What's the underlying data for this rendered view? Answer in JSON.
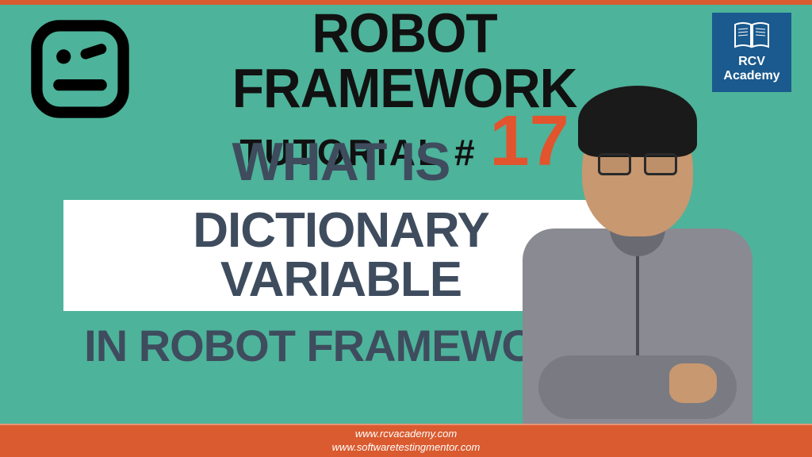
{
  "header": {
    "main_title": "ROBOT FRAMEWORK",
    "tutorial_label": "TUTORIAL #",
    "tutorial_number": "17"
  },
  "badge": {
    "line1": "RCV",
    "line2": "Academy"
  },
  "content": {
    "line1": "WHAT IS",
    "highlight": "DICTIONARY VARIABLE",
    "line2": "IN ROBOT FRAMEWORK"
  },
  "footer": {
    "url1": "www.rcvacademy.com",
    "url2": "www.softwaretestingmentor.com"
  }
}
